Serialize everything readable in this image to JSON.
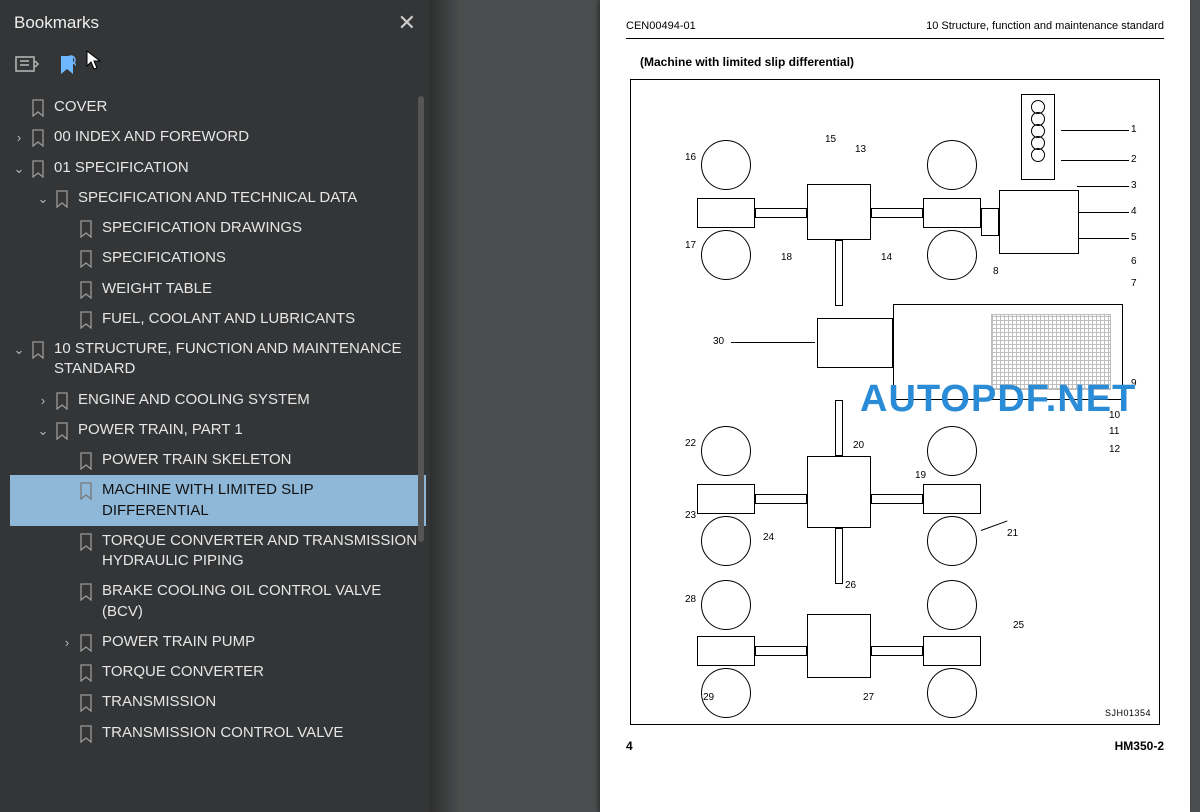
{
  "sidebar": {
    "title": "Bookmarks",
    "items": [
      {
        "chev": "",
        "lvl": 0,
        "label": "COVER"
      },
      {
        "chev": ">",
        "lvl": 0,
        "label": "00 INDEX AND FOREWORD"
      },
      {
        "chev": "v",
        "lvl": 0,
        "label": "01 SPECIFICATION"
      },
      {
        "chev": "v",
        "lvl": 1,
        "label": "SPECIFICATION AND TECHNICAL DATA"
      },
      {
        "chev": "",
        "lvl": 2,
        "label": "SPECIFICATION DRAWINGS"
      },
      {
        "chev": "",
        "lvl": 2,
        "label": "SPECIFICATIONS"
      },
      {
        "chev": "",
        "lvl": 2,
        "label": "WEIGHT TABLE"
      },
      {
        "chev": "",
        "lvl": 2,
        "label": "FUEL, COOLANT AND LUBRICANTS"
      },
      {
        "chev": "v",
        "lvl": 0,
        "label": "10 STRUCTURE, FUNCTION AND MAINTENANCE STANDARD"
      },
      {
        "chev": ">",
        "lvl": 1,
        "label": "ENGINE AND COOLING SYSTEM"
      },
      {
        "chev": "v",
        "lvl": 1,
        "label": "POWER TRAIN, PART 1"
      },
      {
        "chev": "",
        "lvl": 2,
        "label": "POWER TRAIN SKELETON"
      },
      {
        "chev": "",
        "lvl": 2,
        "label": "MACHINE WITH LIMITED SLIP DIFFERENTIAL",
        "selected": true
      },
      {
        "chev": "",
        "lvl": 2,
        "label": "TORQUE CONVERTER AND TRANSMISSION HYDRAULIC PIPING"
      },
      {
        "chev": "",
        "lvl": 2,
        "label": "BRAKE COOLING OIL CONTROL VALVE (BCV)"
      },
      {
        "chev": ">",
        "lvl": 2,
        "label": "POWER TRAIN PUMP"
      },
      {
        "chev": "",
        "lvl": 2,
        "label": "TORQUE CONVERTER"
      },
      {
        "chev": "",
        "lvl": 2,
        "label": "TRANSMISSION"
      },
      {
        "chev": "",
        "lvl": 2,
        "label": "TRANSMISSION CONTROL VALVE"
      }
    ]
  },
  "page": {
    "doc_id": "CEN00494-01",
    "section": "10 Structure, function and maintenance standard",
    "subtitle": "(Machine with limited slip differential)",
    "diagram_code": "SJH01354",
    "page_num": "4",
    "model": "HM350-2",
    "callouts": [
      "1",
      "2",
      "3",
      "4",
      "5",
      "6",
      "7",
      "8",
      "9",
      "10",
      "11",
      "12",
      "13",
      "14",
      "15",
      "16",
      "17",
      "18",
      "19",
      "20",
      "21",
      "22",
      "23",
      "24",
      "25",
      "26",
      "27",
      "28",
      "29",
      "30"
    ]
  },
  "watermark": "AUTOPDF.NET"
}
